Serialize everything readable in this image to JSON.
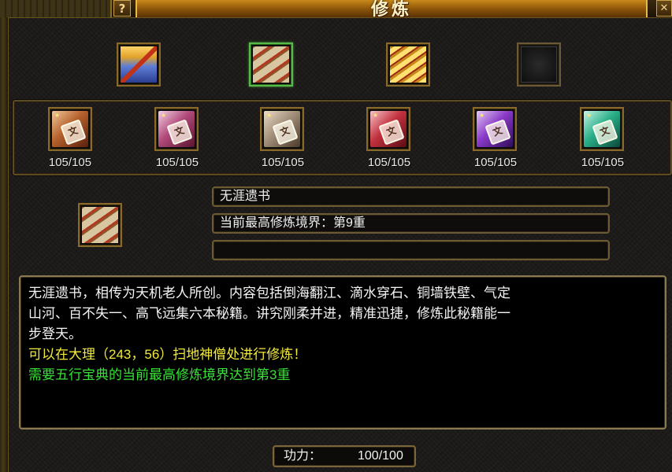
{
  "window": {
    "title": "修炼",
    "help_label": "?",
    "close_label": "✕"
  },
  "top_categories": [
    {
      "name": "book",
      "selected": false
    },
    {
      "name": "scrolls",
      "selected": true
    },
    {
      "name": "gold-scrolls",
      "selected": false
    },
    {
      "name": "empty",
      "selected": false
    }
  ],
  "books": [
    {
      "count": "105/105",
      "glyph": "文"
    },
    {
      "count": "105/105",
      "glyph": "文"
    },
    {
      "count": "105/105",
      "glyph": "文"
    },
    {
      "count": "105/105",
      "glyph": "文"
    },
    {
      "count": "105/105",
      "glyph": "文"
    },
    {
      "count": "105/105",
      "glyph": "文"
    }
  ],
  "detail": {
    "name": "无涯遗书",
    "realm": "当前最高修炼境界：第9重",
    "extra": ""
  },
  "description": {
    "line1": "无涯遗书，相传为天机老人所创。内容包括倒海翻江、滴水穿石、铜墙铁壁、气定",
    "line2": "山河、百不失一、高飞远集六本秘籍。讲究刚柔并进，精准迅捷，修炼此秘籍能一",
    "line3": "步登天。",
    "location": "可以在大理（243，56）扫地神僧处进行修炼！",
    "requirement": "需要五行宝典的当前最高修炼境界达到第3重"
  },
  "power": {
    "label": "功力：",
    "value": "100/100"
  }
}
